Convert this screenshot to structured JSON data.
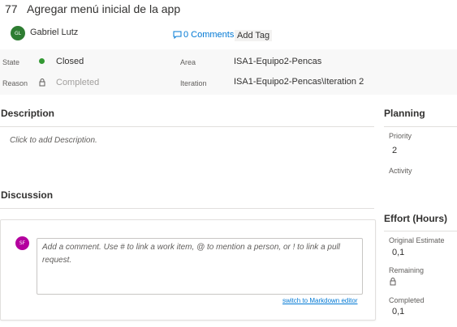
{
  "work_item": {
    "id": "77",
    "title": "Agregar menú inicial de la app",
    "assignee": {
      "initials": "GL",
      "name": "Gabriel Lutz",
      "avatar_color": "#2e7d32"
    },
    "comments_link": "0 Comments",
    "add_tag_label": "Add Tag"
  },
  "fields": {
    "state": {
      "label": "State",
      "value": "Closed",
      "dot_color": "#339933"
    },
    "reason": {
      "label": "Reason",
      "value": "Completed"
    },
    "area": {
      "label": "Area",
      "value": "ISA1-Equipo2-Pencas"
    },
    "iteration": {
      "label": "Iteration",
      "value": "ISA1-Equipo2-Pencas\\Iteration 2"
    }
  },
  "description": {
    "heading": "Description",
    "placeholder": "Click to add Description."
  },
  "discussion": {
    "heading": "Discussion",
    "user_initials": "SF",
    "user_avatar_color": "#b4009e",
    "comment_placeholder": "Add a comment. Use # to link a work item, @ to mention a person, or ! to link a pull request.",
    "markdown_switch": "switch to Markdown editor"
  },
  "planning": {
    "heading": "Planning",
    "priority_label": "Priority",
    "priority_value": "2",
    "activity_label": "Activity"
  },
  "effort": {
    "heading": "Effort (Hours)",
    "original_estimate_label": "Original Estimate",
    "original_estimate_value": "0,1",
    "remaining_label": "Remaining",
    "completed_label": "Completed",
    "completed_value": "0,1"
  },
  "icons": {
    "comment": "comment-icon",
    "lock": "lock-icon"
  }
}
